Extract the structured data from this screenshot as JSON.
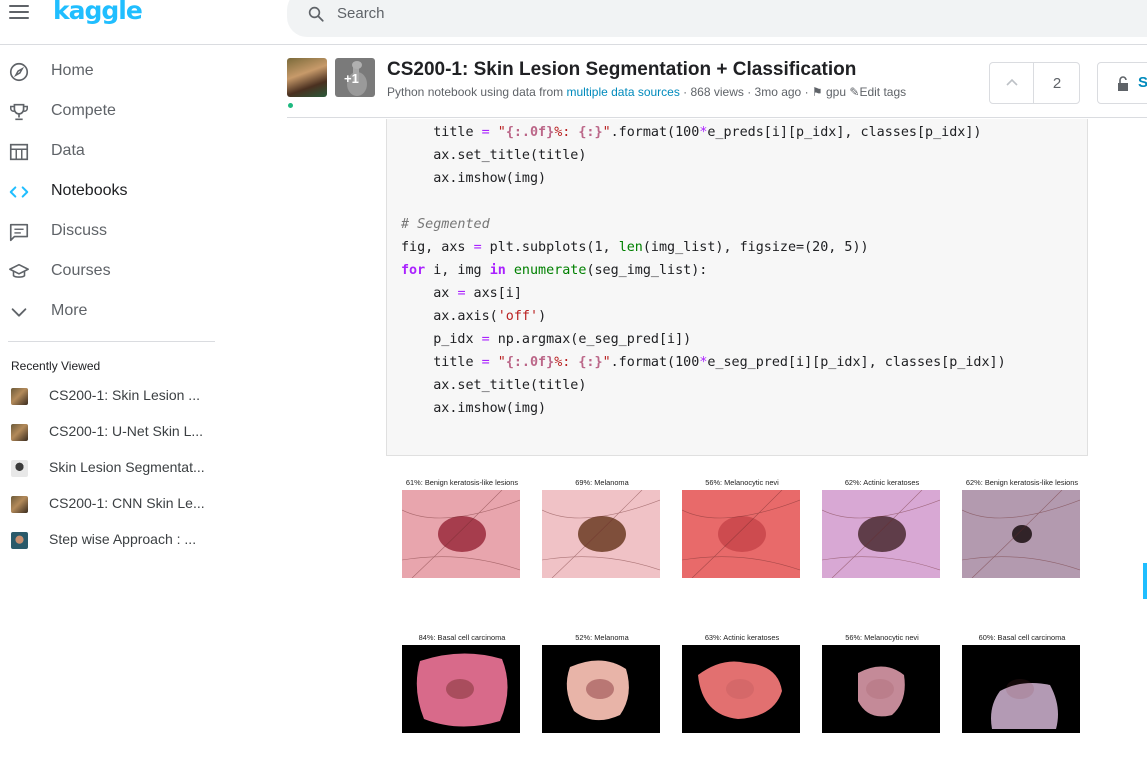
{
  "brand": {
    "logo_text": "kaggle",
    "accent_color": "#20beff"
  },
  "search": {
    "placeholder": "Search"
  },
  "sidebar": {
    "items": [
      {
        "label": "Home",
        "icon": "compass-icon",
        "active": false
      },
      {
        "label": "Compete",
        "icon": "trophy-icon",
        "active": false
      },
      {
        "label": "Data",
        "icon": "table-icon",
        "active": false
      },
      {
        "label": "Notebooks",
        "icon": "code-icon",
        "active": true
      },
      {
        "label": "Discuss",
        "icon": "comment-icon",
        "active": false
      },
      {
        "label": "Courses",
        "icon": "school-icon",
        "active": false
      },
      {
        "label": "More",
        "icon": "chevron-down-icon",
        "active": false
      }
    ],
    "recent_title": "Recently Viewed",
    "recent": [
      {
        "label": "CS200-1: Skin Lesion ..."
      },
      {
        "label": "CS200-1: U-Net Skin L..."
      },
      {
        "label": "Skin Lesion Segmentat..."
      },
      {
        "label": "CS200-1: CNN Skin Le..."
      },
      {
        "label": "Step wise Approach : ..."
      }
    ]
  },
  "notebook": {
    "title": "CS200-1: Skin Lesion Segmentation + Classification",
    "meta_prefix": "Python notebook using data from ",
    "meta_link": "multiple data sources",
    "meta_views": " · 868 views · 3mo ago · ",
    "meta_tag": "gpu",
    "meta_edit": "Edit tags",
    "collaborators_badge": "+1",
    "vote_count": "2",
    "share_label": "S"
  },
  "code_lines": [
    "    title = \"{:.0f}%: {:}\".format(100*e_preds[i][p_idx], classes[p_idx])",
    "    ax.set_title(title)",
    "    ax.imshow(img)",
    "",
    "# Segmented",
    "fig, axs = plt.subplots(1, len(img_list), figsize=(20, 5))",
    "for i, img in enumerate(seg_img_list):",
    "    ax = axs[i]",
    "    ax.axis('off')",
    "    p_idx = np.argmax(e_seg_pred[i])",
    "    title = \"{:.0f}%: {:}\".format(100*e_seg_pred[i][p_idx], classes[p_idx])",
    "    ax.set_title(title)",
    "    ax.imshow(img)"
  ],
  "output": {
    "row1": [
      {
        "caption": "61%: Benign keratosis-like lesions",
        "bg": "#e8a5ad",
        "lesion": "#9a2a3c"
      },
      {
        "caption": "69%: Melanoma",
        "bg": "#f0c2c6",
        "lesion": "#6b3b22"
      },
      {
        "caption": "56%: Melanocytic nevi",
        "bg": "#e86a6a",
        "lesion": "#c8454a"
      },
      {
        "caption": "62%: Actinic keratoses",
        "bg": "#d8a8d4",
        "lesion": "#4a2a30"
      },
      {
        "caption": "62%: Benign keratosis-like lesions",
        "bg": "#b39aaf",
        "lesion": "#1a0e10"
      }
    ],
    "row2": [
      {
        "caption": "84%: Basal cell carcinoma",
        "bg": "#000000",
        "lesion": "#d86a8a"
      },
      {
        "caption": "52%: Melanoma",
        "bg": "#000000",
        "lesion": "#e8b4a8"
      },
      {
        "caption": "63%: Actinic keratoses",
        "bg": "#000000",
        "lesion": "#e27070"
      },
      {
        "caption": "56%: Melanocytic nevi",
        "bg": "#000000",
        "lesion": "#c48a98"
      },
      {
        "caption": "60%: Basal cell carcinoma",
        "bg": "#000000",
        "lesion": "#b39ab4"
      }
    ]
  }
}
